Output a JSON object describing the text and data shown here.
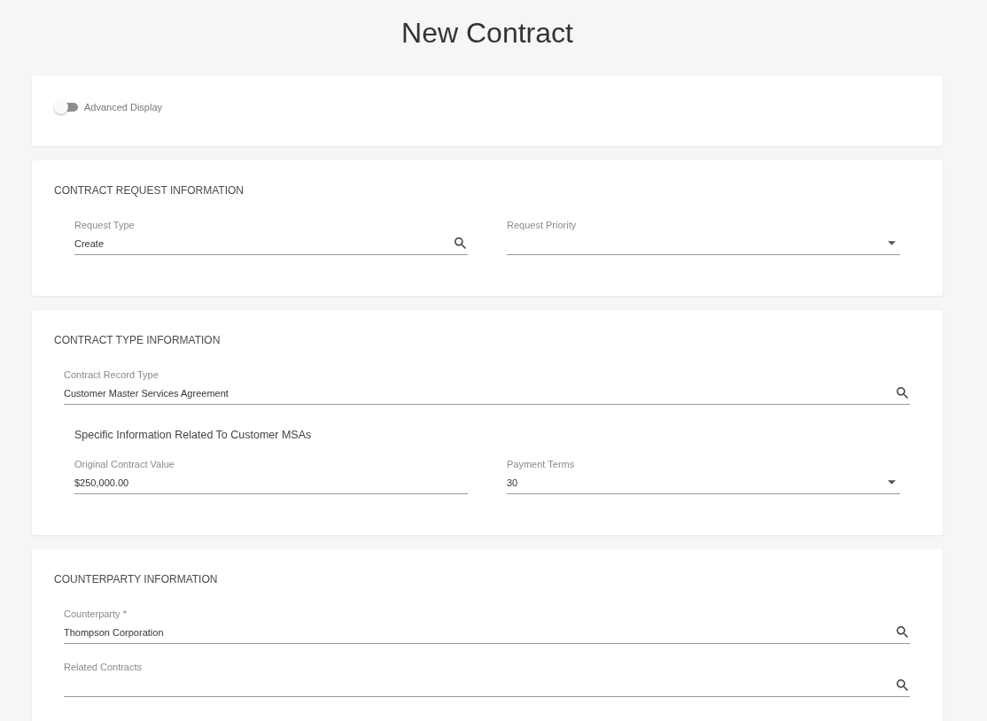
{
  "title": "New Contract",
  "advanced_display": {
    "label": "Advanced Display",
    "on": false
  },
  "sections": [
    {
      "heading": "CONTRACT REQUEST INFORMATION",
      "blocks": [
        {
          "kind": "pair",
          "fields": [
            {
              "kind": "lookup",
              "label": "Request Type",
              "value": "Create"
            },
            {
              "kind": "select",
              "label": "Request Priority"
            }
          ]
        }
      ]
    },
    {
      "heading": "CONTRACT TYPE INFORMATION",
      "blocks": [
        {
          "kind": "wide",
          "fields": [
            {
              "kind": "lookup",
              "label": "Contract Record Type",
              "value": "Customer Master Services Agreement"
            }
          ]
        },
        {
          "kind": "subheading",
          "text": "Specific Information Related To Customer MSAs"
        },
        {
          "kind": "pair",
          "fields": [
            {
              "kind": "text",
              "label": "Original Contract Value",
              "value": "$250,000.00"
            },
            {
              "kind": "select",
              "label": "Payment Terms",
              "value": "30"
            }
          ]
        }
      ]
    },
    {
      "heading": "COUNTERPARTY INFORMATION",
      "blocks": [
        {
          "kind": "wide",
          "fields": [
            {
              "kind": "lookup",
              "label": "Counterparty *",
              "value": "Thompson Corporation"
            },
            {
              "kind": "lookup",
              "label": "Related Contracts"
            }
          ]
        }
      ]
    }
  ]
}
